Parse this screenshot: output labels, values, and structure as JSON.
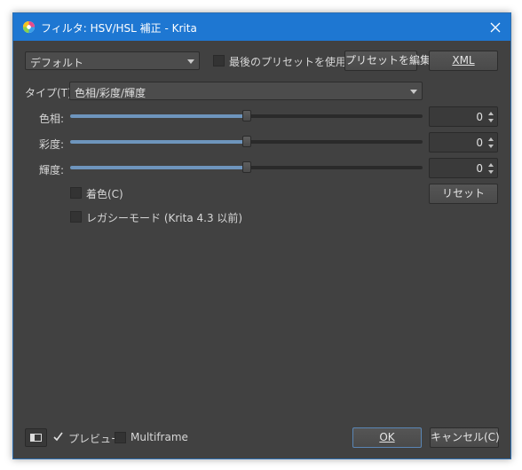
{
  "window": {
    "title": "フィルタ: HSV/HSL 補正 - Krita"
  },
  "toolbar": {
    "preset_value": "デフォルト",
    "use_last_preset_label": "最後のプリセットを使用",
    "edit_preset_label": "プリセットを編集",
    "xml_label": "XML"
  },
  "type_row": {
    "label": "タイプ(T):",
    "value": "色相/彩度/輝度"
  },
  "sliders": [
    {
      "label": "色相:",
      "value": "0",
      "fraction": 0.5
    },
    {
      "label": "彩度:",
      "value": "0",
      "fraction": 0.5
    },
    {
      "label": "輝度:",
      "value": "0",
      "fraction": 0.5
    }
  ],
  "options": {
    "colorize_label": "着色(C)",
    "legacy_label": "レガシーモード (Krita 4.3 以前)",
    "reset_label": "リセット"
  },
  "footer": {
    "preview_label": "プレビュー",
    "preview_checked": true,
    "multiframe_label": "Multiframe",
    "ok_label": "OK",
    "cancel_label": "キャンセル(C)"
  },
  "colors": {
    "titlebar": "#1e77d2",
    "background": "#414141",
    "slider_fill": "#6e95bd"
  }
}
